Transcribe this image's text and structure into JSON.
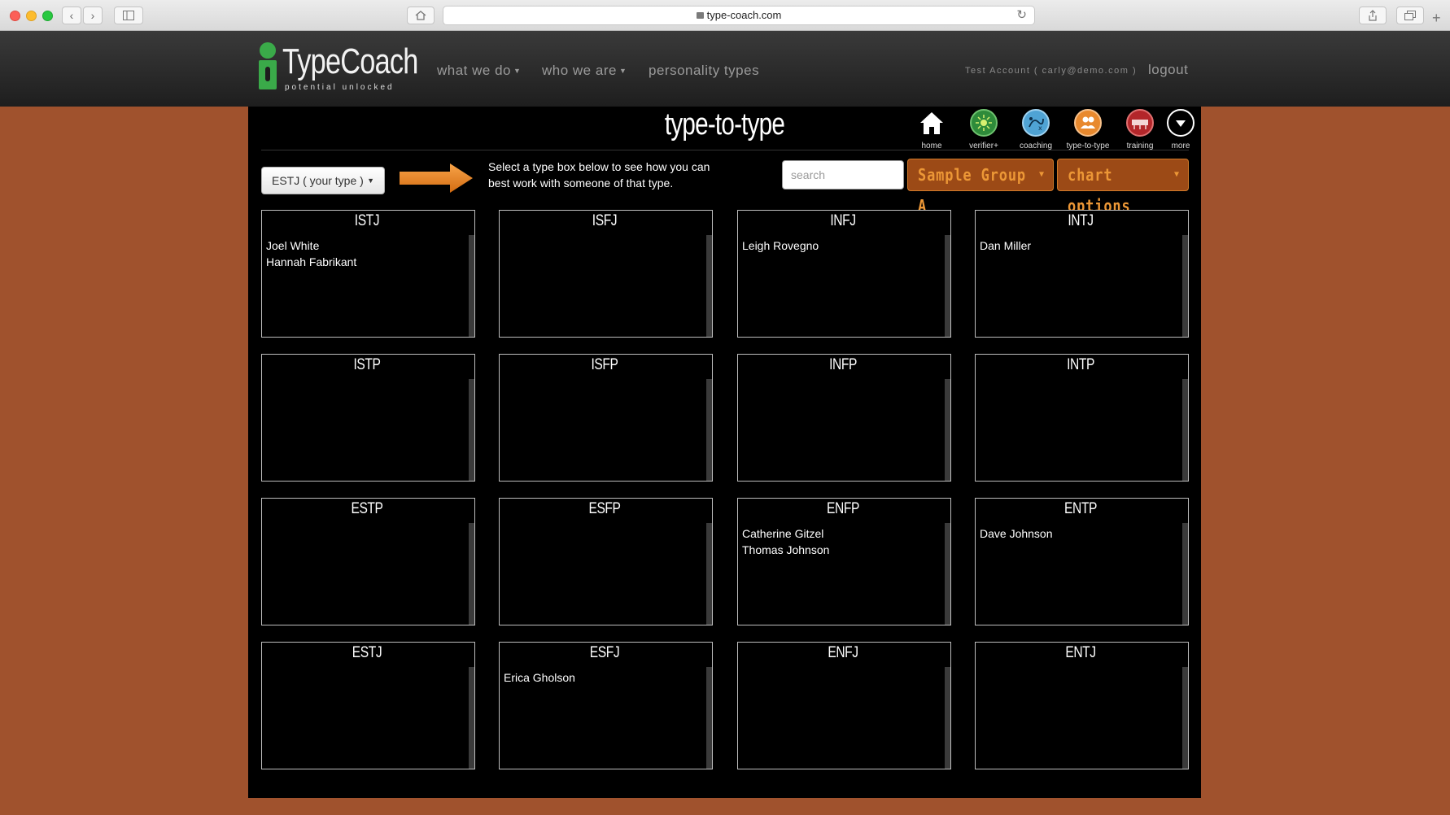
{
  "browser": {
    "url": "type-coach.com"
  },
  "header": {
    "logo_text": "TypeCoach",
    "logo_tagline": "potential unlocked",
    "nav": [
      {
        "label": "what we do"
      },
      {
        "label": "who we are"
      },
      {
        "label": "personality types"
      }
    ],
    "account": "Test Account ( carly@demo.com )",
    "logout": "logout"
  },
  "page": {
    "title": "type-to-type",
    "tools": [
      {
        "label": "home",
        "icon": "home-icon",
        "color": "#000000"
      },
      {
        "label": "verifier+",
        "icon": "verifier-icon",
        "color": "#2e8b3a"
      },
      {
        "label": "coaching",
        "icon": "coaching-icon",
        "color": "#4fa3d4"
      },
      {
        "label": "type-to-type",
        "icon": "type-to-type-icon",
        "color": "#e8892e"
      },
      {
        "label": "training",
        "icon": "training-icon",
        "color": "#b3262a"
      },
      {
        "label": "more",
        "icon": "more-icon",
        "color": "#000000"
      }
    ],
    "type_select": "ESTJ ( your type )",
    "instruction": "Select a type box below to see how you can best work with someone of that type.",
    "search_placeholder": "search",
    "group_button": "Sample Group A",
    "chart_options_button": "chart options",
    "accent_color": "#ec9736"
  },
  "types": [
    {
      "name": "ISTJ",
      "members": [
        "Joel White",
        "Hannah Fabrikant"
      ]
    },
    {
      "name": "ISFJ",
      "members": []
    },
    {
      "name": "INFJ",
      "members": [
        "Leigh Rovegno"
      ]
    },
    {
      "name": "INTJ",
      "members": [
        "Dan Miller"
      ]
    },
    {
      "name": "ISTP",
      "members": []
    },
    {
      "name": "ISFP",
      "members": []
    },
    {
      "name": "INFP",
      "members": []
    },
    {
      "name": "INTP",
      "members": []
    },
    {
      "name": "ESTP",
      "members": []
    },
    {
      "name": "ESFP",
      "members": []
    },
    {
      "name": "ENFP",
      "members": [
        "Catherine Gitzel",
        "Thomas Johnson"
      ]
    },
    {
      "name": "ENTP",
      "members": [
        "Dave Johnson"
      ]
    },
    {
      "name": "ESTJ",
      "members": []
    },
    {
      "name": "ESFJ",
      "members": [
        "Erica Gholson"
      ]
    },
    {
      "name": "ENFJ",
      "members": []
    },
    {
      "name": "ENTJ",
      "members": []
    }
  ]
}
